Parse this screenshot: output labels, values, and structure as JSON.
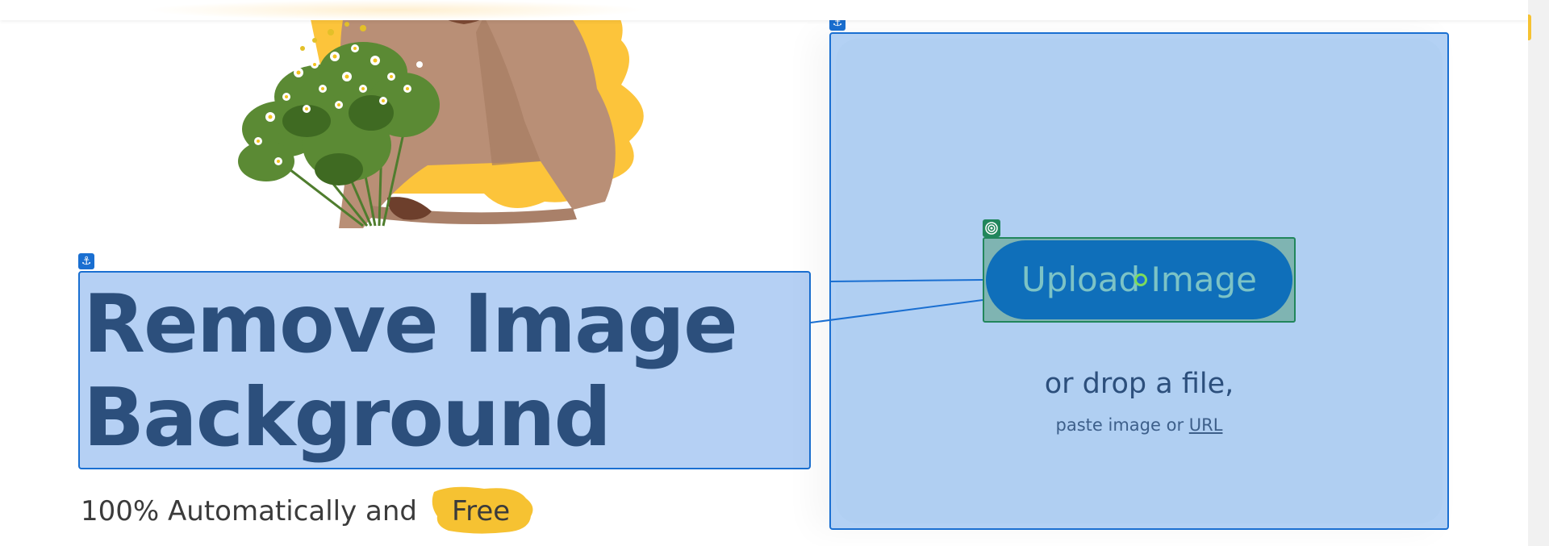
{
  "hero": {
    "headline_line1": "Remove Image",
    "headline_line2": "Background",
    "tagline": "100% Automatically and",
    "free_label": "Free"
  },
  "upload": {
    "button_label": "Upload Image",
    "drop_text": "or drop a file,",
    "paste_prefix": "paste image or",
    "url_link": "URL"
  },
  "icons": {
    "anchor": "anchor-icon",
    "target": "target-icon"
  },
  "colors": {
    "accent_yellow": "#f6c232",
    "highlight_blue": "#1a6fd1",
    "button_blue": "#0f6fba",
    "headline_text": "#2c4f7c",
    "selection_green": "#21865c"
  }
}
